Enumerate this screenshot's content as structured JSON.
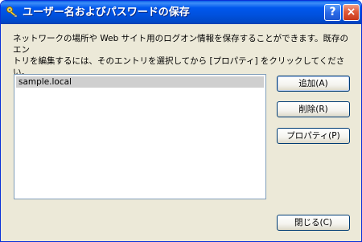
{
  "window": {
    "title": "ユーザー名およびパスワードの保存",
    "help_label": "?",
    "close_label": "×"
  },
  "description": "ネットワークの場所や Web サイト用のログオン情報を保存することができます。既存のエン\nトリを編集するには、そのエントリを選択してから [プロパティ] をクリックしてください。",
  "credentials_list": {
    "items": [
      "sample.local"
    ],
    "selected_index": 0
  },
  "buttons": {
    "add": "追加(A)",
    "delete": "削除(R)",
    "properties": "プロパティ(P)",
    "close": "閉じる(C)"
  },
  "colors": {
    "titlebar": "#0058ee",
    "dialog_bg": "#ece9d8",
    "close_button": "#e05a3a",
    "selection": "#cfcfcf"
  },
  "icons": {
    "title": "keys-icon",
    "help": "help-icon",
    "close": "close-icon"
  }
}
